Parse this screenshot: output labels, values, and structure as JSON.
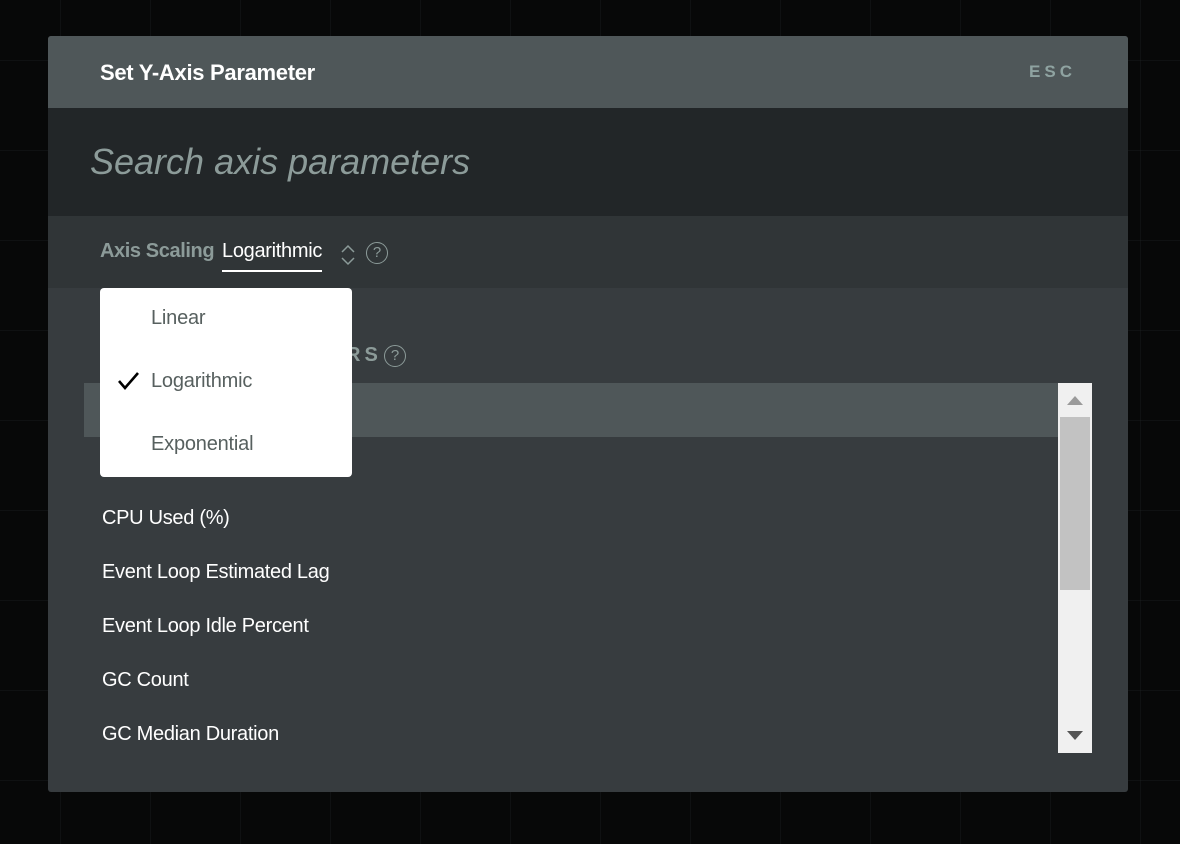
{
  "modal": {
    "title": "Set Y-Axis Parameter",
    "close_hint": "ESC"
  },
  "search": {
    "placeholder": "Search axis parameters",
    "value": ""
  },
  "scaling": {
    "label": "Axis Scaling",
    "selected": "Logarithmic",
    "sort_icon": "chevron-up-down-icon",
    "help_icon": "question-circle-icon",
    "options": [
      {
        "label": "Linear",
        "checked": false
      },
      {
        "label": "Logarithmic",
        "checked": true
      },
      {
        "label": "Exponential",
        "checked": false
      }
    ]
  },
  "parameters": {
    "heading_visible_fragment": "RS",
    "help_icon": "question-circle-icon",
    "items": [
      {
        "label": "",
        "highlighted": true
      },
      {
        "label": "",
        "highlighted": false
      },
      {
        "label": "CPU Used (%)",
        "highlighted": false
      },
      {
        "label": "Event Loop Estimated Lag",
        "highlighted": false
      },
      {
        "label": "Event Loop Idle Percent",
        "highlighted": false
      },
      {
        "label": "GC Count",
        "highlighted": false
      },
      {
        "label": "GC Median Duration",
        "highlighted": false
      }
    ]
  },
  "colors": {
    "header_bg": "#4f5759",
    "search_bg": "#222628",
    "body_bg": "#373c3f",
    "highlight_row": "#4f5759",
    "muted_text": "#8c9b99"
  }
}
